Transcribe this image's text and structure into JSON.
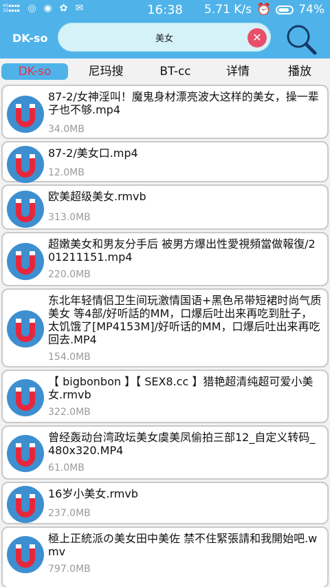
{
  "statusbar": {
    "signal_1": "4G",
    "signal_2": "3G",
    "time": "16:38",
    "speed": "5.71 K/s",
    "battery": "74%"
  },
  "topbar": {
    "brand": "DK-so",
    "search_value": "美女",
    "icons": [
      "clear-icon",
      "search-icon"
    ]
  },
  "tabs": [
    {
      "label": "DK-so",
      "active": true
    },
    {
      "label": "尼玛搜",
      "active": false
    },
    {
      "label": "BT-cc",
      "active": false
    },
    {
      "label": "详情",
      "active": false
    },
    {
      "label": "播放",
      "active": false
    }
  ],
  "results": [
    {
      "title": "87-2/女神淫叫！魔鬼身材漂亮波大这样的美女，操一辈子也不够.mp4",
      "size": "34.0MB"
    },
    {
      "title": "87-2/美女口.mp4",
      "size": "12.0MB"
    },
    {
      "title": "欧美超级美女.rmvb",
      "size": "313.0MB"
    },
    {
      "title": "超嫩美女和男友分手后 被男方爆出性愛視頻當做報復/201211151.mp4",
      "size": "220.0MB"
    },
    {
      "title": "东北年轻情侣卫生间玩激情国语+黑色吊带短裙时尚气质美女 等4部/好听話的MM，口爆后吐出来再吃到肚子，太饥饿了[MP4153M]/好听话的MM，口爆后吐出来再吃回去.MP4",
      "size": "154.0MB"
    },
    {
      "title": "【 bigbonbon 】【 SEX8.cc 】猎艳超清纯超可爱小美女.rmvb",
      "size": "322.0MB"
    },
    {
      "title": "曾经轰动台湾政坛美女虞美凤偷拍三部12_自定义转码_480x320.MP4",
      "size": "61.0MB"
    },
    {
      "title": "16岁小美女.rmvb",
      "size": "237.0MB"
    },
    {
      "title": "極上正統派の美女田中美佐 禁不住緊張請和我開始吧.wmv",
      "size": "797.0MB"
    }
  ]
}
